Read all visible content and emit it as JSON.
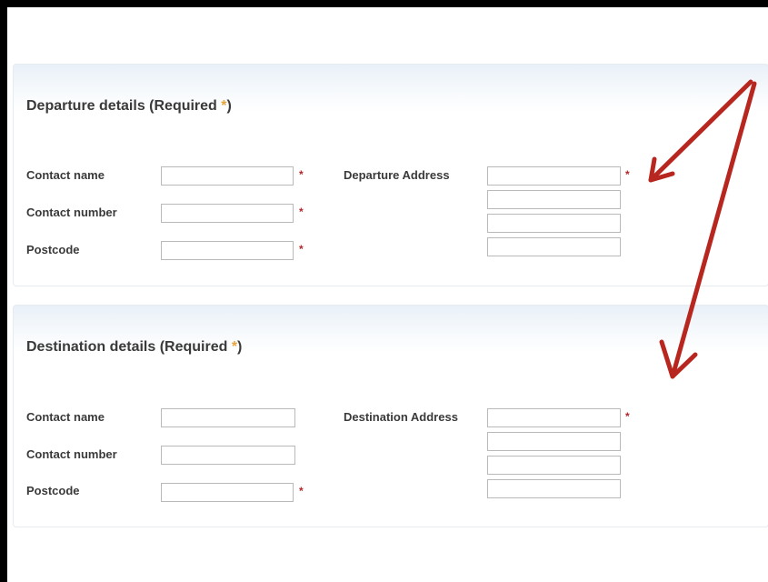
{
  "departure": {
    "title_prefix": "Departure details (Required ",
    "title_star": "*",
    "title_suffix": ")",
    "contact_name_label": "Contact name",
    "contact_number_label": "Contact number",
    "postcode_label": "Postcode",
    "address_label": "Departure Address",
    "required_star": "*",
    "contact_name_value": "",
    "contact_number_value": "",
    "postcode_value": "",
    "address_line1_value": "",
    "address_line2_value": "",
    "address_line3_value": "",
    "address_line4_value": ""
  },
  "destination": {
    "title_prefix": "Destination details (Required ",
    "title_star": "*",
    "title_suffix": ")",
    "contact_name_label": "Contact name",
    "contact_number_label": "Contact number",
    "postcode_label": "Postcode",
    "address_label": "Destination Address",
    "required_star": "*",
    "contact_name_value": "",
    "contact_number_value": "",
    "postcode_value": "",
    "address_line1_value": "",
    "address_line2_value": "",
    "address_line3_value": "",
    "address_line4_value": ""
  },
  "colors": {
    "required_star": "#b3282d",
    "title_star": "#e8a33b",
    "annotation_arrow": "#b8271f"
  }
}
